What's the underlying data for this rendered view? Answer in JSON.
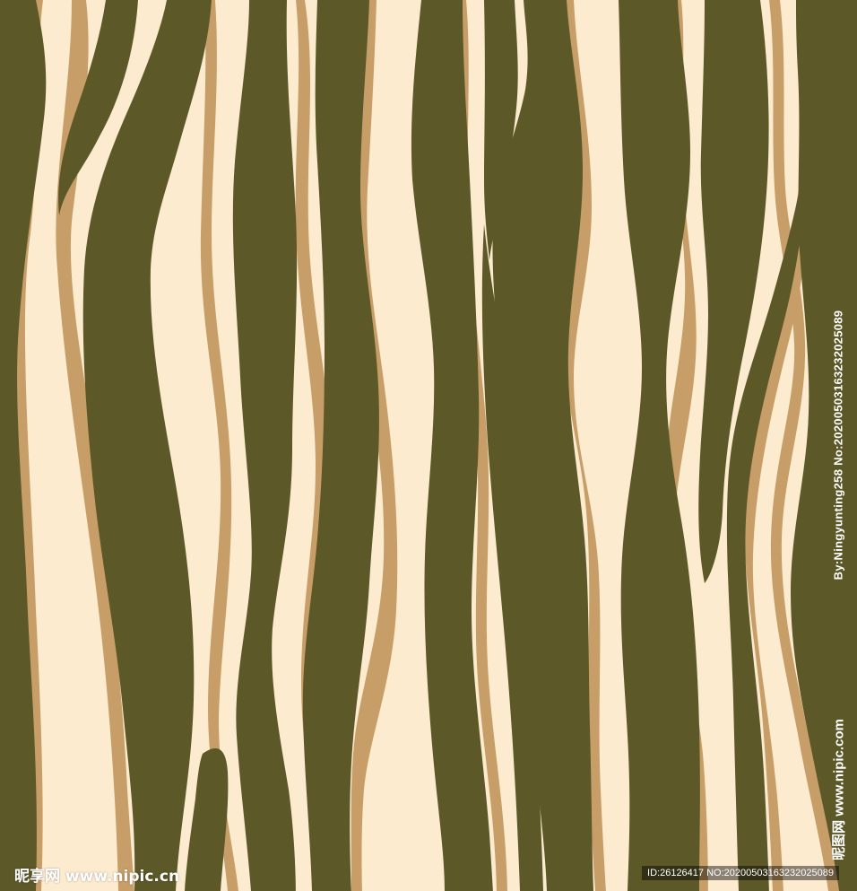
{
  "colors": {
    "background_cream": "#FCEBCF",
    "stripe_olive": "#5C5828",
    "stripe_tan_edge": "#C79E68"
  },
  "watermarks": {
    "vertical_author": "By:Ningyunting258 No:20200503163232025089",
    "vertical_site": "昵图网 www.nipic.com",
    "logo": "昵享网 www.nipic.cn",
    "id_line": "ID:26126417 NO:20200503163232025089"
  }
}
